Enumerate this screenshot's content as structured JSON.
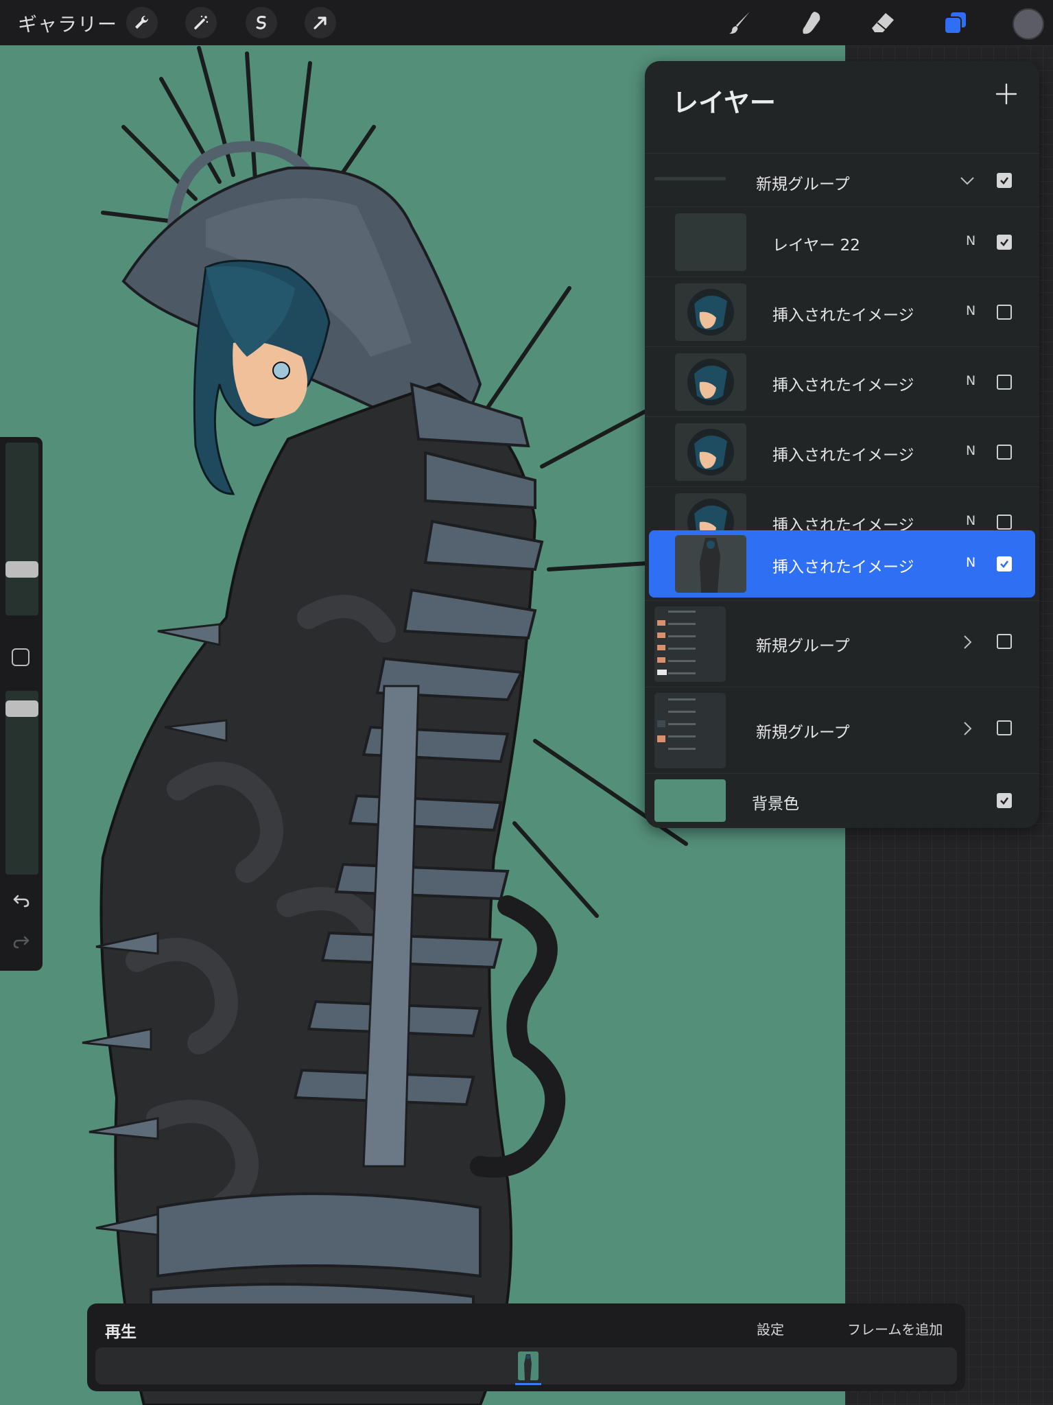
{
  "toolbar": {
    "gallery_label": "ギャラリー",
    "left_tools": [
      "wrench-icon",
      "magic-wand-icon",
      "selection-icon",
      "transform-arrow-icon"
    ],
    "right_tools": [
      "brush-icon",
      "smudge-icon",
      "eraser-icon",
      "layers-icon"
    ],
    "active_tool": "layers-icon",
    "current_color": "#5c5c66"
  },
  "sidebar": {
    "brush_size": 0.83,
    "opacity": 0.79,
    "buttons": [
      "modifier-square-icon",
      "undo-icon",
      "redo-icon"
    ]
  },
  "layers": {
    "title": "レイヤー",
    "add_icon": "plus-icon",
    "rows": [
      {
        "label": "新規グループ",
        "mode": "",
        "checked": true,
        "type": "group-expanded"
      },
      {
        "label": "レイヤー 22",
        "mode": "N",
        "checked": true,
        "type": "layer"
      },
      {
        "label": "挿入されたイメージ",
        "mode": "N",
        "checked": false,
        "type": "layer"
      },
      {
        "label": "挿入されたイメージ",
        "mode": "N",
        "checked": false,
        "type": "layer"
      },
      {
        "label": "挿入されたイメージ",
        "mode": "N",
        "checked": false,
        "type": "layer"
      },
      {
        "label": "挿入されたイメージ",
        "mode": "N",
        "checked": false,
        "type": "layer"
      },
      {
        "label": "挿入されたイメージ",
        "mode": "N",
        "checked": true,
        "type": "layer-selected"
      },
      {
        "label": "新規グループ",
        "mode": "",
        "checked": false,
        "type": "group-collapsed"
      },
      {
        "label": "新規グループ",
        "mode": "",
        "checked": false,
        "type": "group-collapsed"
      },
      {
        "label": "背景色",
        "mode": "",
        "checked": true,
        "type": "background"
      }
    ],
    "background_color": "#548f7a",
    "selected_color": "#2f6ff4"
  },
  "animation": {
    "play_label": "再生",
    "settings_label": "設定",
    "add_frame_label": "フレームを追加",
    "frame_count": 1
  }
}
